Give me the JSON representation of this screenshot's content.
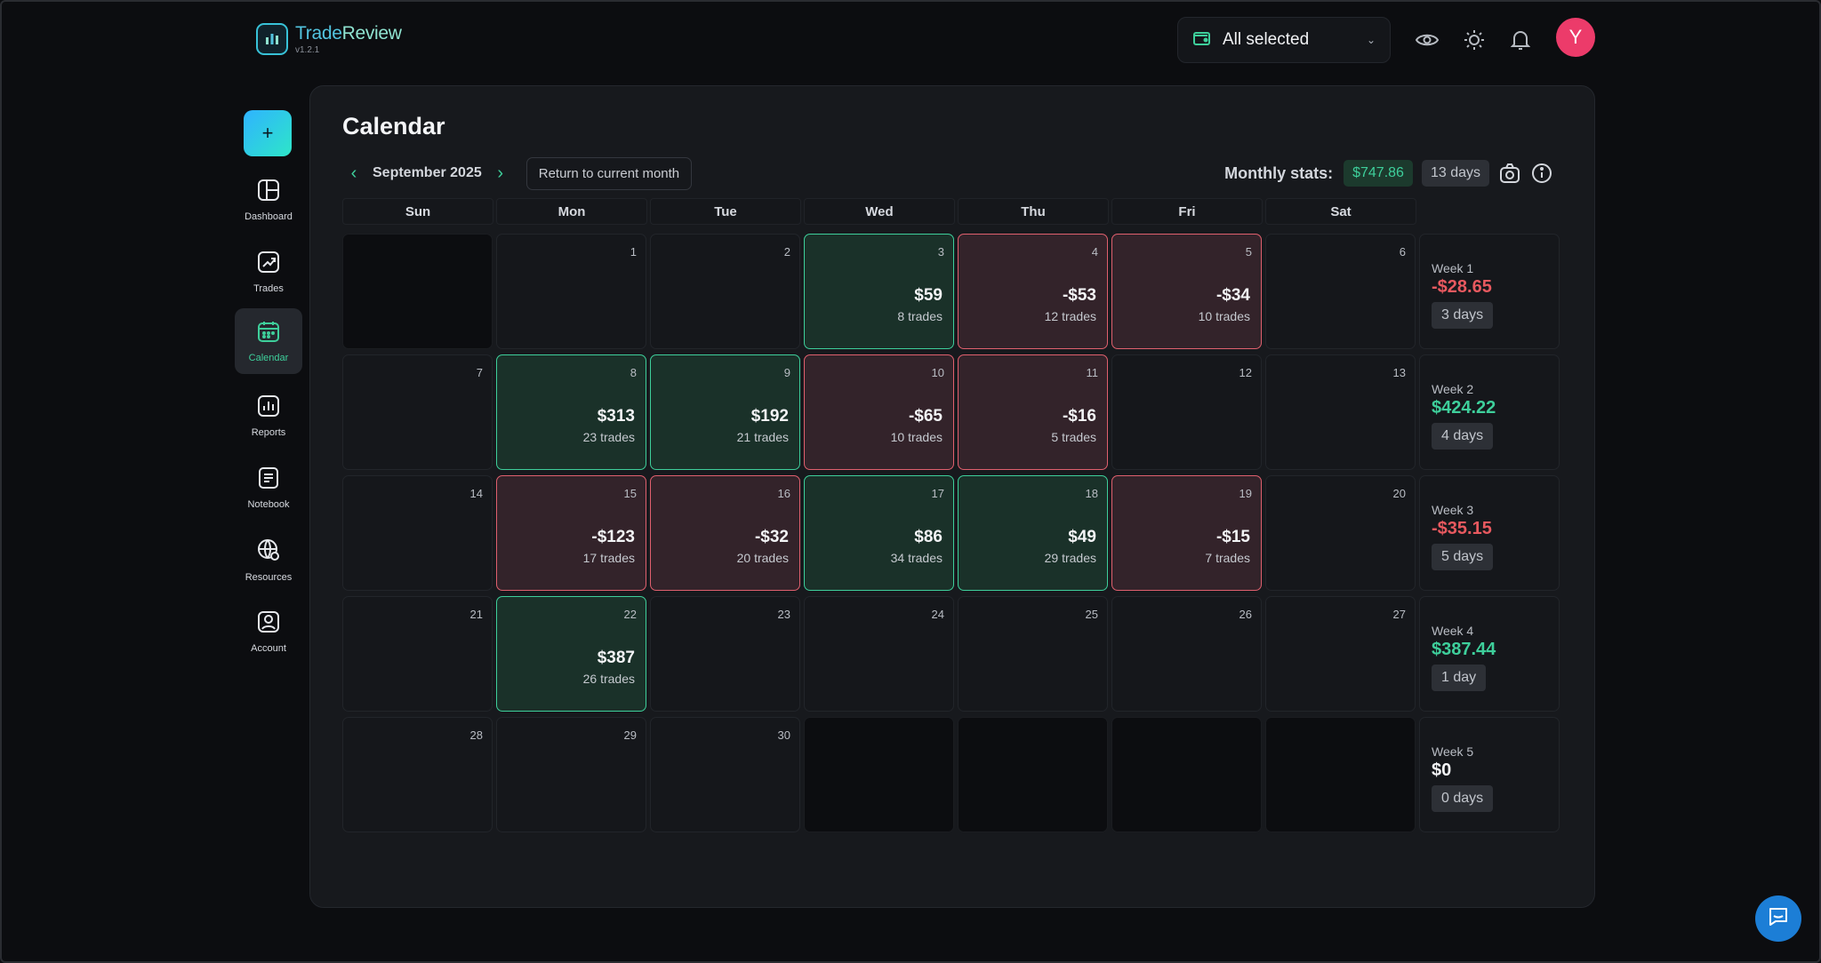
{
  "app": {
    "name_part1": "Trade",
    "name_part2": "Review",
    "version": "v1.2.1"
  },
  "header": {
    "account_selector": "All selected"
  },
  "avatar_letter": "Y",
  "colors": {
    "accent": "#3ecf9b",
    "loss": "#e0606e",
    "avatar": "#ec3b6a",
    "chat": "#1c7ed6"
  },
  "sidebar": {
    "add_label": "+",
    "items": [
      {
        "label": "Dashboard",
        "icon": "dashboard-icon"
      },
      {
        "label": "Trades",
        "icon": "trades-icon"
      },
      {
        "label": "Calendar",
        "icon": "calendar-icon",
        "active": true
      },
      {
        "label": "Reports",
        "icon": "reports-icon"
      },
      {
        "label": "Notebook",
        "icon": "notebook-icon"
      },
      {
        "label": "Resources",
        "icon": "resources-icon"
      },
      {
        "label": "Account",
        "icon": "account-icon"
      }
    ]
  },
  "calendar": {
    "title": "Calendar",
    "month_label": "September 2025",
    "return_label": "Return to current month",
    "monthly_stats": {
      "label": "Monthly stats:",
      "pnl": "$747.86",
      "days": "13 days"
    },
    "weekdays": [
      "Sun",
      "Mon",
      "Tue",
      "Wed",
      "Thu",
      "Fri",
      "Sat"
    ],
    "weeks": [
      {
        "label": "Week 1",
        "pnl": "-$28.65",
        "sign": "neg",
        "days": "3 days",
        "cells": [
          {
            "empty": true
          },
          {
            "day": "1"
          },
          {
            "day": "2"
          },
          {
            "day": "3",
            "pnl": "$59",
            "trades": "8 trades",
            "result": "win"
          },
          {
            "day": "4",
            "pnl": "-$53",
            "trades": "12 trades",
            "result": "loss"
          },
          {
            "day": "5",
            "pnl": "-$34",
            "trades": "10 trades",
            "result": "loss"
          },
          {
            "day": "6"
          }
        ]
      },
      {
        "label": "Week 2",
        "pnl": "$424.22",
        "sign": "pos",
        "days": "4 days",
        "cells": [
          {
            "day": "7"
          },
          {
            "day": "8",
            "pnl": "$313",
            "trades": "23 trades",
            "result": "win"
          },
          {
            "day": "9",
            "pnl": "$192",
            "trades": "21 trades",
            "result": "win"
          },
          {
            "day": "10",
            "pnl": "-$65",
            "trades": "10 trades",
            "result": "loss"
          },
          {
            "day": "11",
            "pnl": "-$16",
            "trades": "5 trades",
            "result": "loss"
          },
          {
            "day": "12"
          },
          {
            "day": "13"
          }
        ]
      },
      {
        "label": "Week 3",
        "pnl": "-$35.15",
        "sign": "neg",
        "days": "5 days",
        "cells": [
          {
            "day": "14"
          },
          {
            "day": "15",
            "pnl": "-$123",
            "trades": "17 trades",
            "result": "loss"
          },
          {
            "day": "16",
            "pnl": "-$32",
            "trades": "20 trades",
            "result": "loss"
          },
          {
            "day": "17",
            "pnl": "$86",
            "trades": "34 trades",
            "result": "win"
          },
          {
            "day": "18",
            "pnl": "$49",
            "trades": "29 trades",
            "result": "win"
          },
          {
            "day": "19",
            "pnl": "-$15",
            "trades": "7 trades",
            "result": "loss"
          },
          {
            "day": "20"
          }
        ]
      },
      {
        "label": "Week 4",
        "pnl": "$387.44",
        "sign": "pos",
        "days": "1 day",
        "cells": [
          {
            "day": "21"
          },
          {
            "day": "22",
            "pnl": "$387",
            "trades": "26 trades",
            "result": "win"
          },
          {
            "day": "23"
          },
          {
            "day": "24"
          },
          {
            "day": "25"
          },
          {
            "day": "26"
          },
          {
            "day": "27"
          }
        ]
      },
      {
        "label": "Week 5",
        "pnl": "$0",
        "sign": "zero",
        "days": "0 days",
        "cells": [
          {
            "day": "28"
          },
          {
            "day": "29"
          },
          {
            "day": "30"
          },
          {
            "empty": true
          },
          {
            "empty": true
          },
          {
            "empty": true
          },
          {
            "empty": true
          }
        ]
      }
    ]
  }
}
